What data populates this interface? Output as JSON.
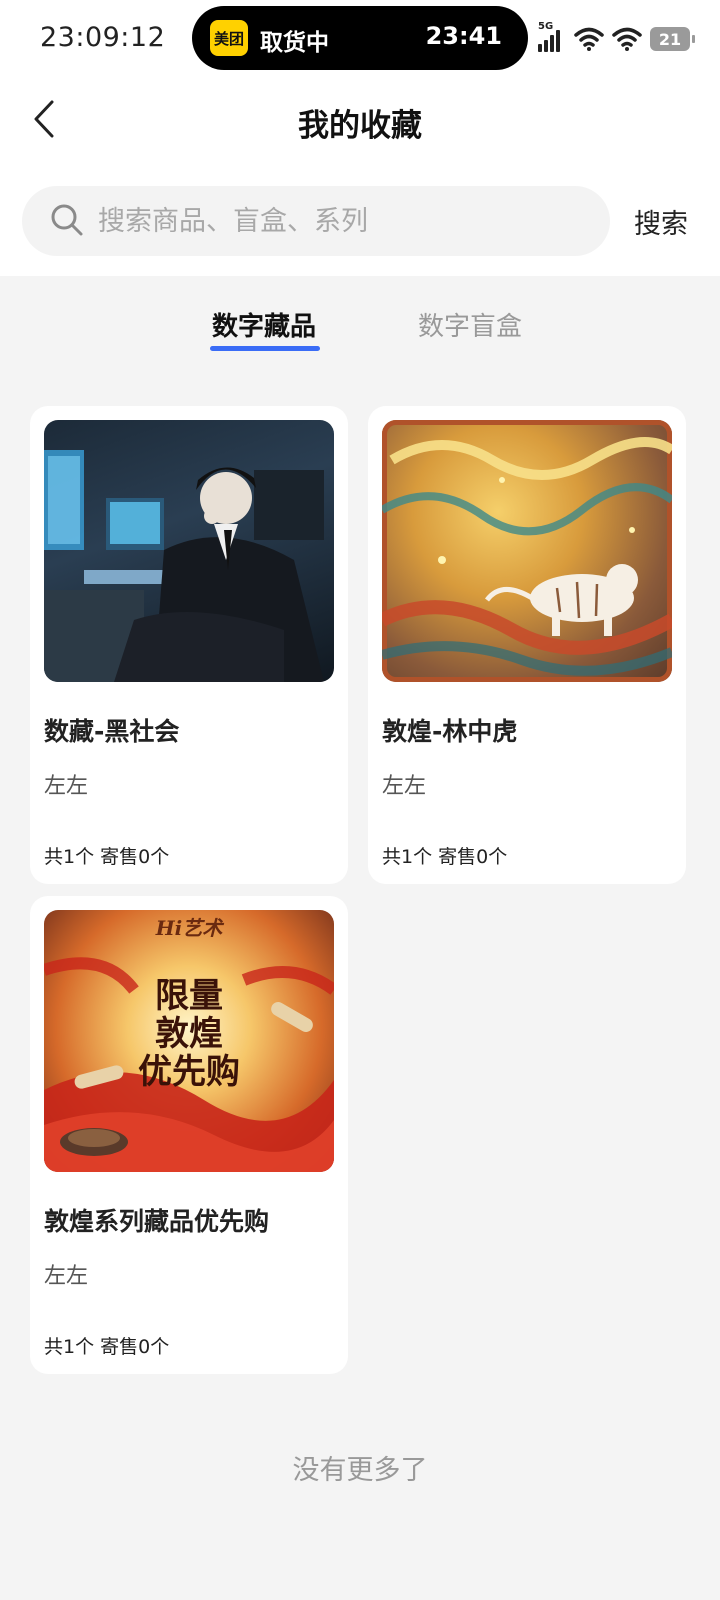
{
  "status_bar": {
    "time": "23:09:12",
    "island_app_logo": "美团",
    "island_text": "取货中",
    "island_time": "23:41",
    "network": "5G",
    "battery": "21"
  },
  "header": {
    "title": "我的收藏"
  },
  "search": {
    "placeholder": "搜索商品、盲盒、系列",
    "button_label": "搜索"
  },
  "tabs": [
    {
      "label": "数字藏品",
      "active": true
    },
    {
      "label": "数字盲盒",
      "active": false
    }
  ],
  "cards": [
    {
      "title": "数藏-黑社会",
      "creator": "左左",
      "meta": "共1个 寄售0个"
    },
    {
      "title": "敦煌-林中虎",
      "creator": "左左",
      "meta": "共1个 寄售0个"
    },
    {
      "title": "敦煌系列藏品优先购",
      "creator": "左左",
      "meta": "共1个 寄售0个",
      "art_logo": "Hi艺术",
      "art_text": [
        "限量",
        "敦煌",
        "优先购"
      ]
    }
  ],
  "footer": {
    "text": "没有更多了"
  },
  "colors": {
    "accent": "#3a6cf6",
    "background": "#f4f4f4"
  }
}
